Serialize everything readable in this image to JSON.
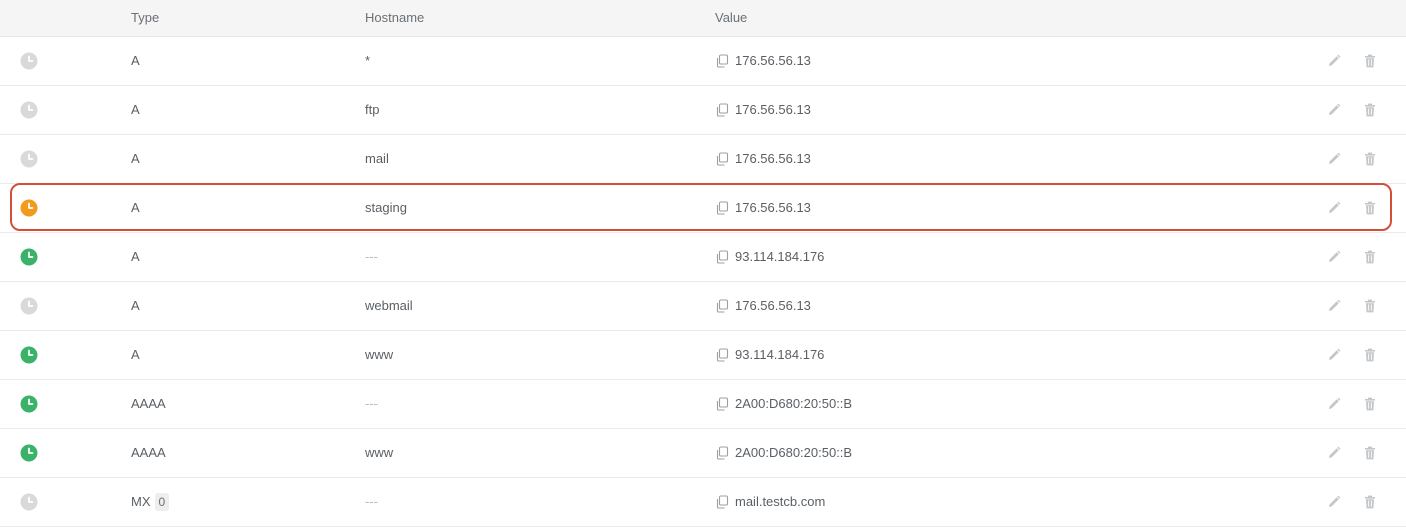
{
  "columns": {
    "type": "Type",
    "hostname": "Hostname",
    "value": "Value"
  },
  "colors": {
    "status_inactive": "#d9d9d9",
    "status_pending": "#f39a1d",
    "status_active": "#3bb26a",
    "highlight_border": "#d2503b"
  },
  "records": [
    {
      "status": "inactive",
      "status_icon": "clock-icon",
      "type": "A",
      "priority": "",
      "hostname": "*",
      "value": "176.56.56.13"
    },
    {
      "status": "inactive",
      "status_icon": "clock-icon",
      "type": "A",
      "priority": "",
      "hostname": "ftp",
      "value": "176.56.56.13"
    },
    {
      "status": "inactive",
      "status_icon": "clock-icon",
      "type": "A",
      "priority": "",
      "hostname": "mail",
      "value": "176.56.56.13"
    },
    {
      "status": "pending",
      "status_icon": "clock-icon",
      "type": "A",
      "priority": "",
      "hostname": "staging",
      "value": "176.56.56.13",
      "highlighted": true
    },
    {
      "status": "active",
      "status_icon": "clock-icon",
      "type": "A",
      "priority": "",
      "hostname": "---",
      "value": "93.114.184.176"
    },
    {
      "status": "inactive",
      "status_icon": "clock-icon",
      "type": "A",
      "priority": "",
      "hostname": "webmail",
      "value": "176.56.56.13"
    },
    {
      "status": "active",
      "status_icon": "clock-icon",
      "type": "A",
      "priority": "",
      "hostname": "www",
      "value": "93.114.184.176"
    },
    {
      "status": "active",
      "status_icon": "clock-icon",
      "type": "AAAA",
      "priority": "",
      "hostname": "---",
      "value": "2A00:D680:20:50::B"
    },
    {
      "status": "active",
      "status_icon": "clock-icon",
      "type": "AAAA",
      "priority": "",
      "hostname": "www",
      "value": "2A00:D680:20:50::B"
    },
    {
      "status": "inactive",
      "status_icon": "clock-icon",
      "type": "MX",
      "priority": "0",
      "hostname": "---",
      "value": "mail.testcb.com"
    }
  ]
}
